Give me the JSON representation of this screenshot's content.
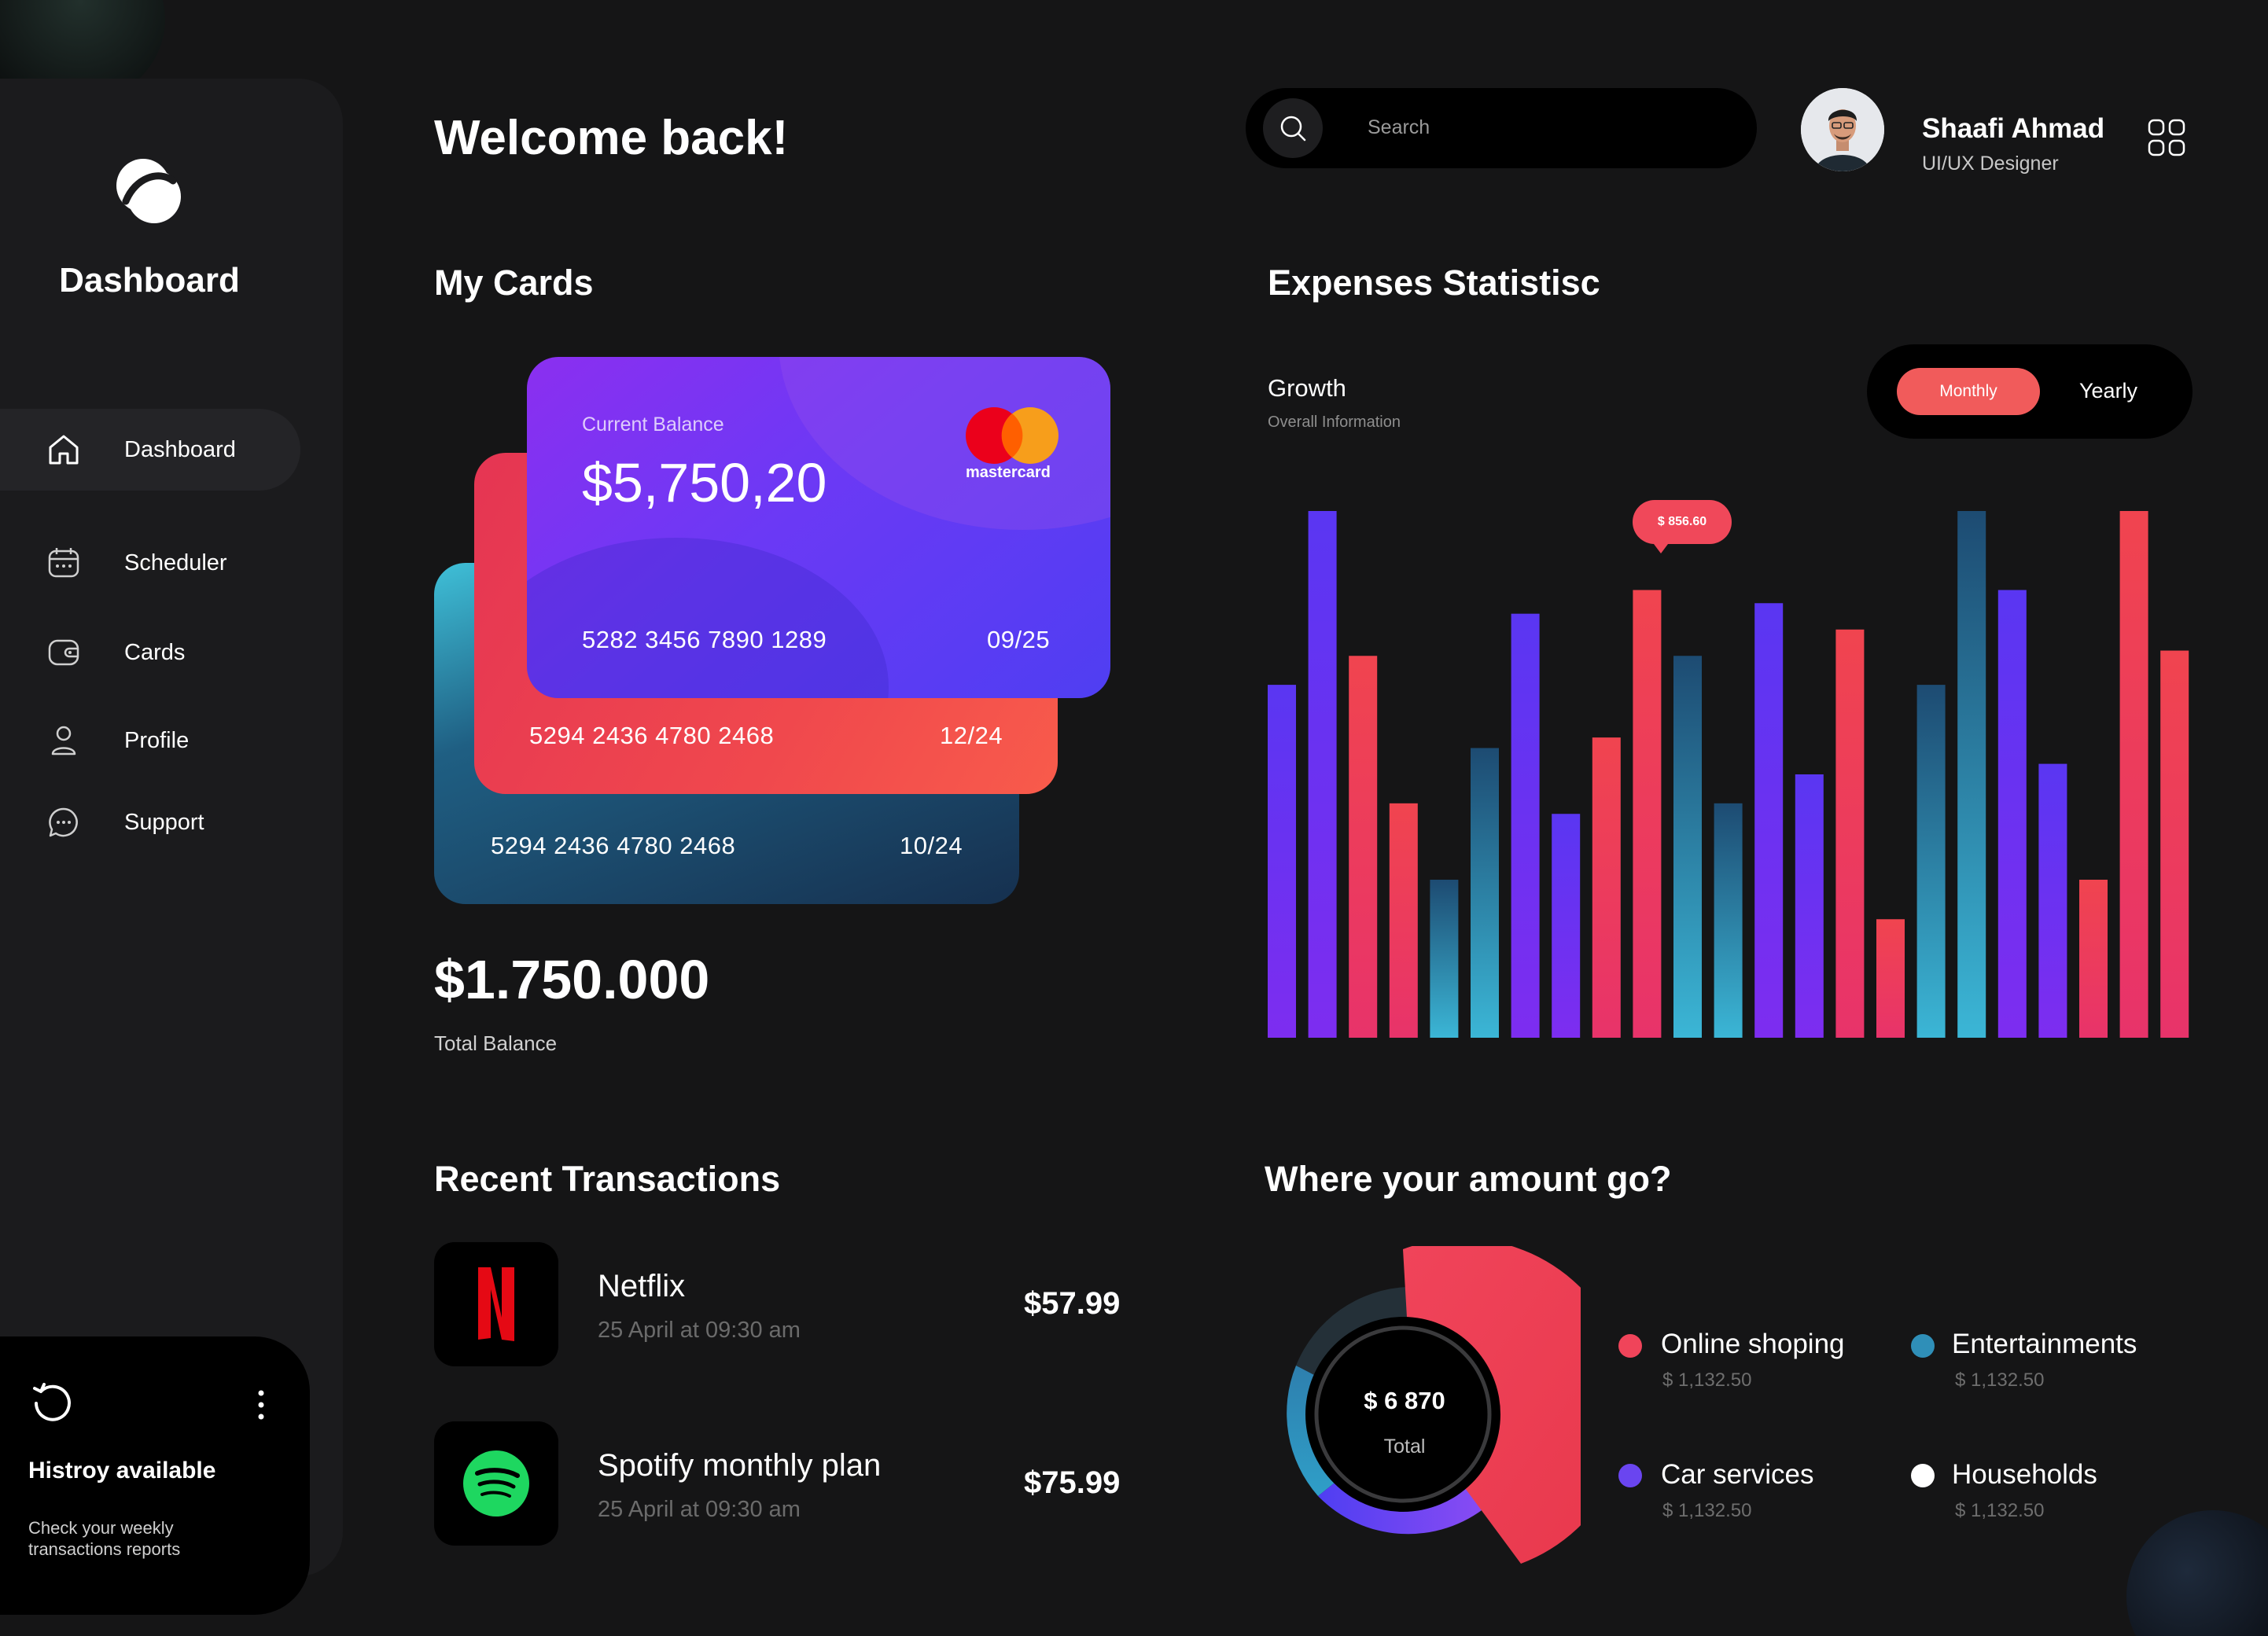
{
  "sidebar": {
    "title": "Dashboard",
    "items": [
      {
        "label": "Dashboard",
        "icon": "home-icon",
        "active": true
      },
      {
        "label": "Scheduler",
        "icon": "calendar-icon"
      },
      {
        "label": "Cards",
        "icon": "wallet-icon"
      },
      {
        "label": "Profile",
        "icon": "user-icon"
      },
      {
        "label": "Support",
        "icon": "chat-icon"
      }
    ],
    "history": {
      "title": "Histroy available",
      "subtitle": "Check your weekly transactions reports"
    }
  },
  "header": {
    "welcome": "Welcome back!",
    "search_placeholder": "Search",
    "user_name": "Shaafi Ahmad",
    "user_role": "UI/UX Designer"
  },
  "cards": {
    "title": "My Cards",
    "balance_label": "Current Balance",
    "balance": "$5,750,20",
    "brand": "mastercard",
    "list": [
      {
        "number": "5282 3456 7890 1289",
        "expiry": "09/25"
      },
      {
        "number": "5294 2436 4780 2468",
        "expiry": "12/24"
      },
      {
        "number": "5294 2436 4780 2468",
        "expiry": "10/24"
      }
    ],
    "total": "$1.750.000",
    "total_label": "Total Balance"
  },
  "transactions": {
    "title": "Recent Transactions",
    "items": [
      {
        "name": "Netflix",
        "date": "25 April at 09:30 am",
        "amount": "$57.99",
        "icon": "netflix-icon"
      },
      {
        "name": "Spotify monthly plan",
        "date": "25 April at 09:30 am",
        "amount": "$75.99",
        "icon": "spotify-icon"
      }
    ]
  },
  "expenses": {
    "title": "Expenses Statistisc",
    "growth_label": "Growth",
    "growth_sub": "Overall Information",
    "toggle": {
      "monthly": "Monthly",
      "yearly": "Yearly",
      "selected": "Monthly"
    },
    "tooltip": "$ 856.60"
  },
  "chart_data": {
    "type": "bar",
    "colors": {
      "purple": "#5b3cf0",
      "red": "#f0445a",
      "teal": "#2f9cc4"
    },
    "values": [
      {
        "v": 67,
        "c": "purple"
      },
      {
        "v": 100,
        "c": "purple"
      },
      {
        "v": 72.5,
        "c": "red"
      },
      {
        "v": 44.5,
        "c": "red"
      },
      {
        "v": 30,
        "c": "teal"
      },
      {
        "v": 55,
        "c": "teal"
      },
      {
        "v": 80.5,
        "c": "purple"
      },
      {
        "v": 42.5,
        "c": "purple"
      },
      {
        "v": 57,
        "c": "red"
      },
      {
        "v": 85,
        "c": "red"
      },
      {
        "v": 72.5,
        "c": "teal"
      },
      {
        "v": 44.5,
        "c": "teal"
      },
      {
        "v": 82.5,
        "c": "purple"
      },
      {
        "v": 50,
        "c": "purple"
      },
      {
        "v": 77.5,
        "c": "red"
      },
      {
        "v": 22.5,
        "c": "red"
      },
      {
        "v": 67,
        "c": "teal"
      },
      {
        "v": 100,
        "c": "teal"
      },
      {
        "v": 85,
        "c": "purple"
      },
      {
        "v": 52,
        "c": "purple"
      },
      {
        "v": 30,
        "c": "red"
      },
      {
        "v": 100,
        "c": "red"
      },
      {
        "v": 73.5,
        "c": "red"
      }
    ],
    "ylim": [
      0,
      100
    ],
    "grid": false
  },
  "spending": {
    "title": "Where your amount go?",
    "total": "$ 6 870",
    "total_label": "Total",
    "segments": [
      {
        "name": "Online shoping",
        "value": "$ 1,132.50",
        "color": "#f0445a",
        "share": 0.42
      },
      {
        "name": "Car services",
        "value": "$ 1,132.50",
        "color": "#6a45f0",
        "share": 0.16
      },
      {
        "name": "Entertainments",
        "value": "$ 1,132.50",
        "color": "#2f8fb8",
        "share": 0.22
      },
      {
        "name": "Households",
        "value": "$ 1,132.50",
        "color": "#ffffff",
        "share": 0.2
      }
    ]
  }
}
